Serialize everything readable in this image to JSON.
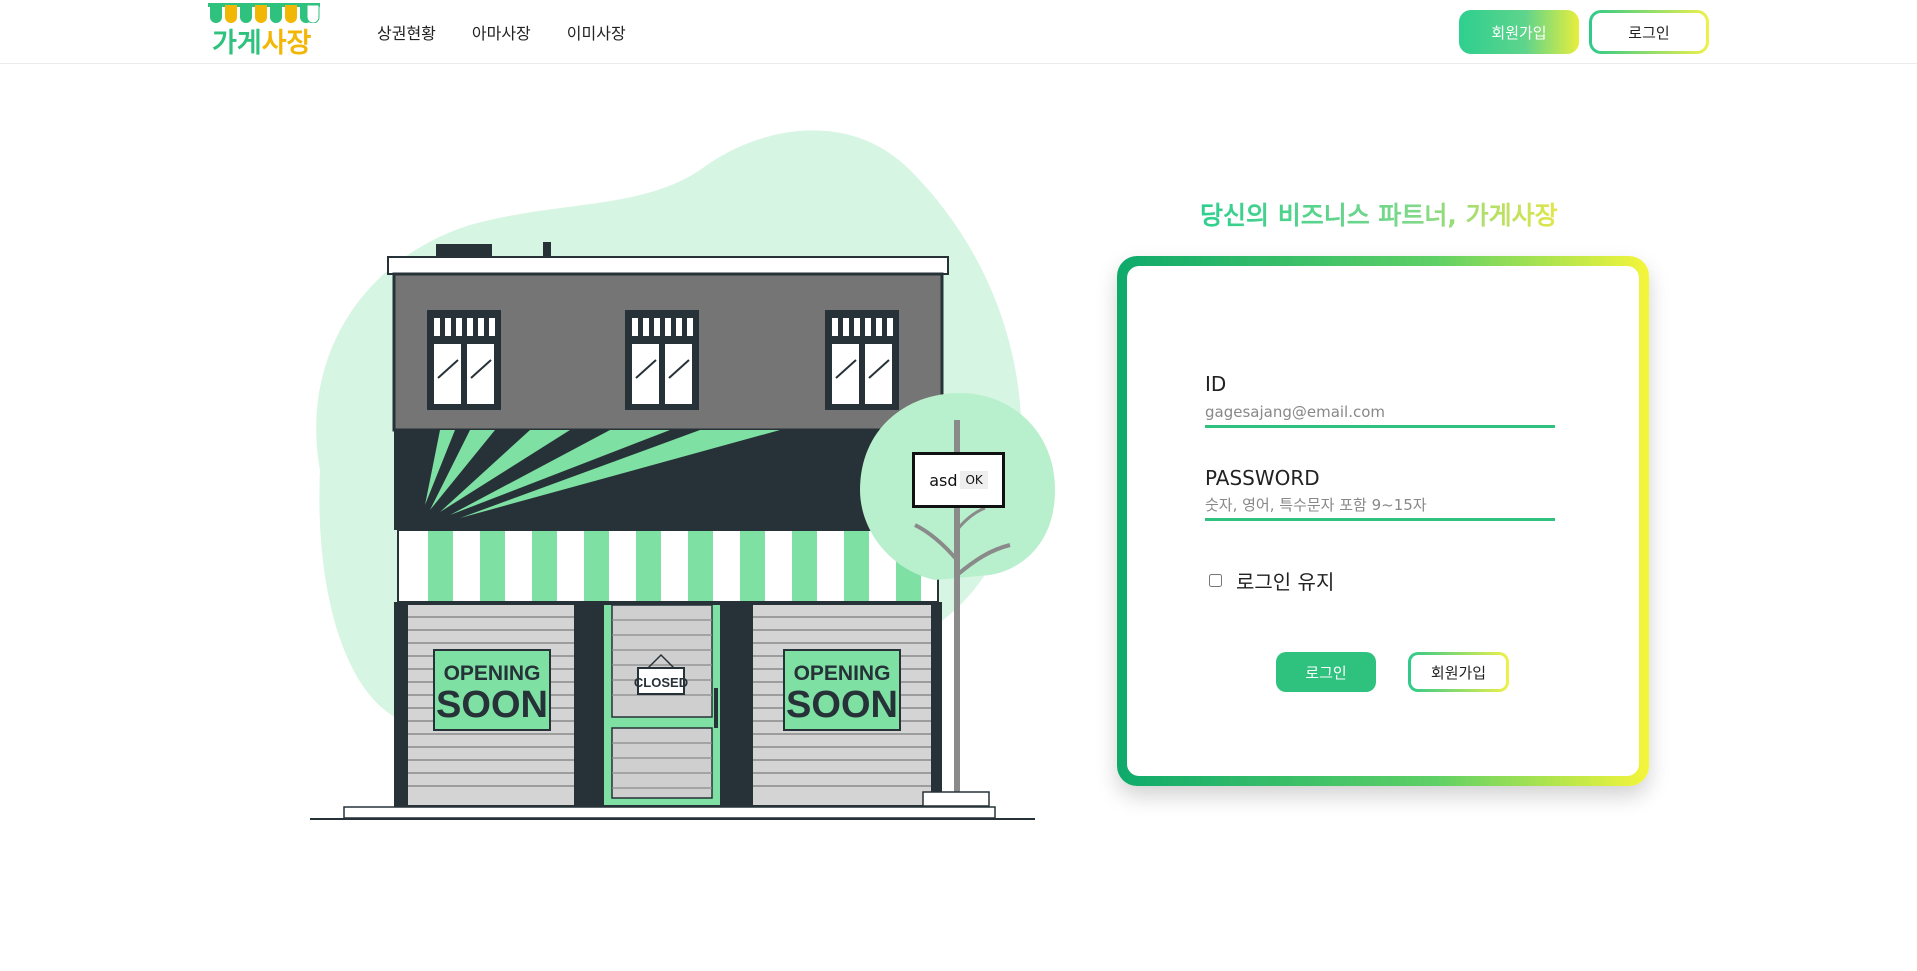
{
  "header": {
    "logo_text_green": "가게",
    "logo_text_yellow": "사장",
    "nav": [
      "상권현황",
      "아마사장",
      "이미사장"
    ],
    "signup_label": "회원가입",
    "login_label": "로그인"
  },
  "illustration": {
    "sign_left": [
      "OPENING",
      "SOON"
    ],
    "sign_right": [
      "OPENING",
      "SOON"
    ],
    "door_sign": "CLOSED"
  },
  "dialog": {
    "text": "asd",
    "ok_label": "OK"
  },
  "login": {
    "tagline": "당신의 비즈니스 파트너, 가게사장",
    "id_label": "ID",
    "id_placeholder": "gagesajang@email.com",
    "password_label": "PASSWORD",
    "password_placeholder": "숫자, 영어, 특수문자 포함 9~15자",
    "keep_login_label": "로그인 유지",
    "keep_login_checked": false,
    "login_button": "로그인",
    "signup_button": "회원가입"
  },
  "colors": {
    "accent": "#2ec27e",
    "accent_yellow": "#f2b705",
    "gradient_end": "#f5f53a",
    "building_dark": "#263238",
    "building_green": "#7ee0a2"
  }
}
